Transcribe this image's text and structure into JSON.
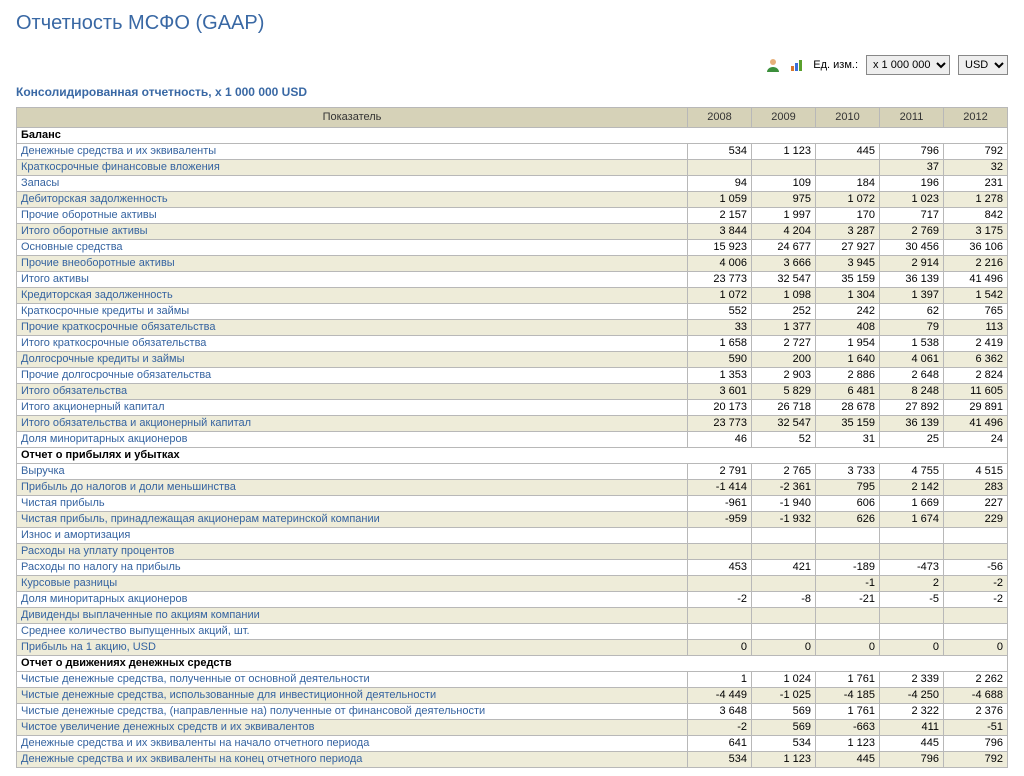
{
  "page_title": "Отчетность МСФО (GAAP)",
  "toolbar": {
    "unit_label": "Ед. изм.:",
    "unit_value": "x 1 000 000",
    "currency_value": "USD"
  },
  "subtitle": "Консолидированная отчетность, x 1 000 000 USD",
  "table": {
    "header_indicator": "Показатель",
    "years": [
      "2008",
      "2009",
      "2010",
      "2011",
      "2012"
    ],
    "rows": [
      {
        "section": true,
        "label": "Баланс"
      },
      {
        "label": "Денежные средства и их эквиваленты",
        "v": [
          "534",
          "1 123",
          "445",
          "796",
          "792"
        ]
      },
      {
        "label": "Краткосрочные финансовые вложения",
        "v": [
          "",
          "",
          "",
          "37",
          "32"
        ]
      },
      {
        "label": "Запасы",
        "v": [
          "94",
          "109",
          "184",
          "196",
          "231"
        ]
      },
      {
        "label": "Дебиторская задолженность",
        "v": [
          "1 059",
          "975",
          "1 072",
          "1 023",
          "1 278"
        ]
      },
      {
        "label": "Прочие оборотные активы",
        "v": [
          "2 157",
          "1 997",
          "170",
          "717",
          "842"
        ]
      },
      {
        "label": "Итого оборотные активы",
        "v": [
          "3 844",
          "4 204",
          "3 287",
          "2 769",
          "3 175"
        ]
      },
      {
        "label": "Основные средства",
        "v": [
          "15 923",
          "24 677",
          "27 927",
          "30 456",
          "36 106"
        ]
      },
      {
        "label": "Прочие внеоборотные активы",
        "v": [
          "4 006",
          "3 666",
          "3 945",
          "2 914",
          "2 216"
        ]
      },
      {
        "label": "Итого активы",
        "v": [
          "23 773",
          "32 547",
          "35 159",
          "36 139",
          "41 496"
        ]
      },
      {
        "label": "Кредиторская задолженность",
        "v": [
          "1 072",
          "1 098",
          "1 304",
          "1 397",
          "1 542"
        ]
      },
      {
        "label": "Краткосрочные кредиты и займы",
        "v": [
          "552",
          "252",
          "242",
          "62",
          "765"
        ]
      },
      {
        "label": "Прочие краткосрочные обязательства",
        "v": [
          "33",
          "1 377",
          "408",
          "79",
          "113"
        ]
      },
      {
        "label": "Итого краткосрочные обязательства",
        "v": [
          "1 658",
          "2 727",
          "1 954",
          "1 538",
          "2 419"
        ]
      },
      {
        "label": "Долгосрочные кредиты и займы",
        "v": [
          "590",
          "200",
          "1 640",
          "4 061",
          "6 362"
        ]
      },
      {
        "label": "Прочие долгосрочные обязательства",
        "v": [
          "1 353",
          "2 903",
          "2 886",
          "2 648",
          "2 824"
        ]
      },
      {
        "label": "Итого обязательства",
        "v": [
          "3 601",
          "5 829",
          "6 481",
          "8 248",
          "11 605"
        ]
      },
      {
        "label": "Итого акционерный капитал",
        "v": [
          "20 173",
          "26 718",
          "28 678",
          "27 892",
          "29 891"
        ]
      },
      {
        "label": "Итого обязательства и акционерный капитал",
        "v": [
          "23 773",
          "32 547",
          "35 159",
          "36 139",
          "41 496"
        ]
      },
      {
        "label": "Доля миноритарных акционеров",
        "v": [
          "46",
          "52",
          "31",
          "25",
          "24"
        ]
      },
      {
        "section": true,
        "label": "Отчет о прибылях и убытках"
      },
      {
        "label": "Выручка",
        "v": [
          "2 791",
          "2 765",
          "3 733",
          "4 755",
          "4 515"
        ]
      },
      {
        "label": "Прибыль до налогов и доли меньшинства",
        "v": [
          "-1 414",
          "-2 361",
          "795",
          "2 142",
          "283"
        ]
      },
      {
        "label": "Чистая прибыль",
        "v": [
          "-961",
          "-1 940",
          "606",
          "1 669",
          "227"
        ]
      },
      {
        "label": "Чистая прибыль, принадлежащая акционерам материнской компании",
        "v": [
          "-959",
          "-1 932",
          "626",
          "1 674",
          "229"
        ]
      },
      {
        "label": "Износ и амортизация",
        "v": [
          "",
          "",
          "",
          "",
          ""
        ]
      },
      {
        "label": "Расходы на уплату процентов",
        "v": [
          "",
          "",
          "",
          "",
          ""
        ]
      },
      {
        "label": "Расходы по налогу на прибыль",
        "v": [
          "453",
          "421",
          "-189",
          "-473",
          "-56"
        ]
      },
      {
        "label": "Курсовые разницы",
        "v": [
          "",
          "",
          "-1",
          "2",
          "-2"
        ]
      },
      {
        "label": "Доля миноритарных акционеров",
        "v": [
          "-2",
          "-8",
          "-21",
          "-5",
          "-2"
        ]
      },
      {
        "label": "Дивиденды выплаченные по акциям компании",
        "v": [
          "",
          "",
          "",
          "",
          ""
        ]
      },
      {
        "label": "Среднее количество выпущенных акций, шт.",
        "v": [
          "",
          "",
          "",
          "",
          ""
        ]
      },
      {
        "label": "Прибыль на 1 акцию, USD",
        "v": [
          "0",
          "0",
          "0",
          "0",
          "0"
        ]
      },
      {
        "section": true,
        "label": "Отчет о движениях денежных средств"
      },
      {
        "label": "Чистые денежные средства, полученные от основной деятельности",
        "v": [
          "1",
          "1 024",
          "1 761",
          "2 339",
          "2 262"
        ]
      },
      {
        "label": "Чистые денежные средства, использованные для инвестиционной деятельности",
        "v": [
          "-4 449",
          "-1 025",
          "-4 185",
          "-4 250",
          "-4 688"
        ]
      },
      {
        "label": "Чистые денежные средства, (направленные на) полученные от финансовой деятельности",
        "v": [
          "3 648",
          "569",
          "1 761",
          "2 322",
          "2 376"
        ]
      },
      {
        "label": "Чистое увеличение денежных средств и их эквивалентов",
        "v": [
          "-2",
          "569",
          "-663",
          "411",
          "-51"
        ]
      },
      {
        "label": "Денежные средства и их эквиваленты на начало отчетного периода",
        "v": [
          "641",
          "534",
          "1 123",
          "445",
          "796"
        ]
      },
      {
        "label": "Денежные средства и их эквиваленты на конец отчетного периода",
        "v": [
          "534",
          "1 123",
          "445",
          "796",
          "792"
        ]
      }
    ]
  }
}
